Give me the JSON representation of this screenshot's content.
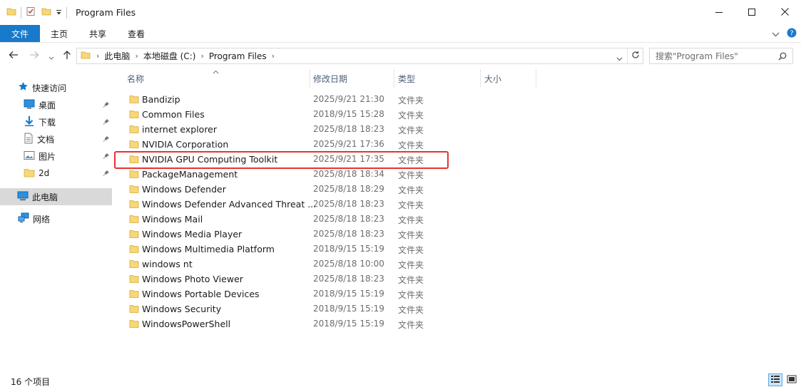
{
  "window": {
    "title": "Program Files"
  },
  "ribbon": {
    "tabs": [
      "文件",
      "主页",
      "共享",
      "查看"
    ]
  },
  "address": {
    "crumbs": [
      "此电脑",
      "本地磁盘 (C:)",
      "Program Files"
    ],
    "search_placeholder": "搜索\"Program Files\""
  },
  "nav": {
    "quick_access": "快速访问",
    "items": [
      {
        "label": "桌面",
        "icon": "desktop-icon"
      },
      {
        "label": "下载",
        "icon": "download-icon"
      },
      {
        "label": "文档",
        "icon": "document-icon"
      },
      {
        "label": "图片",
        "icon": "picture-icon"
      },
      {
        "label": "2d",
        "icon": "folder-icon"
      }
    ],
    "this_pc": "此电脑",
    "network": "网络"
  },
  "columns": {
    "name": "名称",
    "date": "修改日期",
    "type": "类型",
    "size": "大小"
  },
  "files": [
    {
      "name": "Bandizip",
      "date": "2025/9/21 21:30",
      "type": "文件夹"
    },
    {
      "name": "Common Files",
      "date": "2018/9/15 15:28",
      "type": "文件夹"
    },
    {
      "name": "internet explorer",
      "date": "2025/8/18 18:23",
      "type": "文件夹"
    },
    {
      "name": "NVIDIA Corporation",
      "date": "2025/9/21 17:36",
      "type": "文件夹"
    },
    {
      "name": "NVIDIA GPU Computing Toolkit",
      "date": "2025/9/21 17:35",
      "type": "文件夹"
    },
    {
      "name": "PackageManagement",
      "date": "2025/8/18 18:34",
      "type": "文件夹"
    },
    {
      "name": "Windows Defender",
      "date": "2025/8/18 18:29",
      "type": "文件夹"
    },
    {
      "name": "Windows Defender Advanced Threat ...",
      "date": "2025/8/18 18:23",
      "type": "文件夹"
    },
    {
      "name": "Windows Mail",
      "date": "2025/8/18 18:23",
      "type": "文件夹"
    },
    {
      "name": "Windows Media Player",
      "date": "2025/8/18 18:23",
      "type": "文件夹"
    },
    {
      "name": "Windows Multimedia Platform",
      "date": "2018/9/15 15:19",
      "type": "文件夹"
    },
    {
      "name": "windows nt",
      "date": "2025/8/18 10:00",
      "type": "文件夹"
    },
    {
      "name": "Windows Photo Viewer",
      "date": "2025/8/18 18:23",
      "type": "文件夹"
    },
    {
      "name": "Windows Portable Devices",
      "date": "2018/9/15 15:19",
      "type": "文件夹"
    },
    {
      "name": "Windows Security",
      "date": "2018/9/15 15:19",
      "type": "文件夹"
    },
    {
      "name": "WindowsPowerShell",
      "date": "2018/9/15 15:19",
      "type": "文件夹"
    }
  ],
  "status": {
    "item_count": "16 个项目"
  },
  "colors": {
    "accent": "#1979ca",
    "highlight": "#e8322c",
    "folder": "#f8d775"
  }
}
